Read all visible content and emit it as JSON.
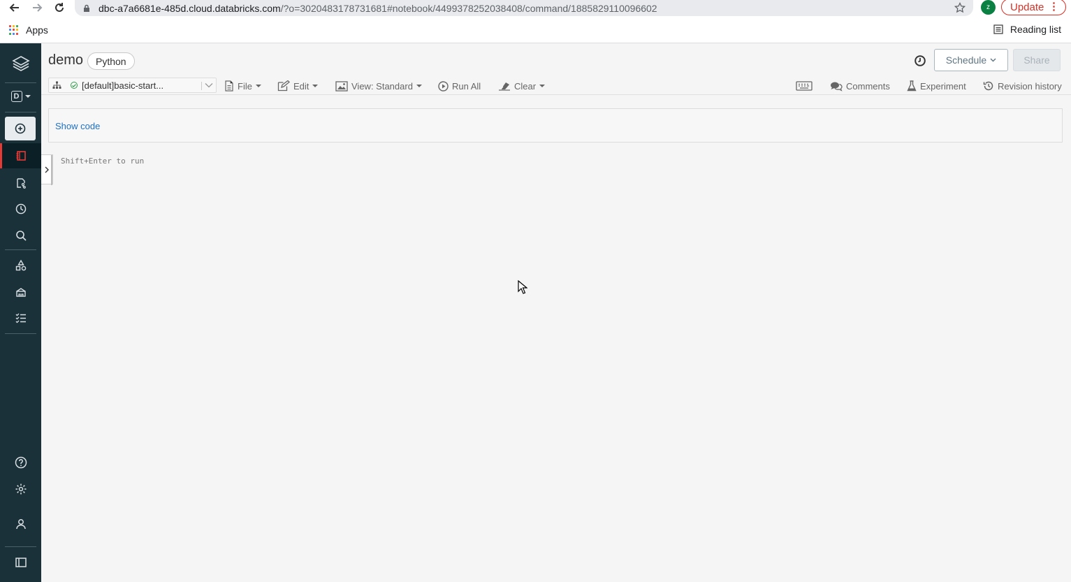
{
  "browser": {
    "url_host": "dbc-a7a6681e-485d.cloud.databricks.com",
    "url_path": "/?o=3020483178731681#notebook/4499378252038408/command/1885829110096602",
    "profile_initial": "z",
    "update_label": "Update",
    "bookmarks": {
      "apps_label": "Apps",
      "reading_list_label": "Reading list"
    }
  },
  "sidebar": {
    "workspace_letter": "D",
    "accent_color": "#e53935",
    "background_color": "#1b3139"
  },
  "notebook": {
    "title": "demo",
    "language": "Python",
    "schedule_label": "Schedule",
    "share_label": "Share"
  },
  "toolbar": {
    "cluster_name": "[default]basic-start...",
    "file_label": "File",
    "edit_label": "Edit",
    "view_label": "View: Standard",
    "run_all_label": "Run All",
    "clear_label": "Clear",
    "comments_label": "Comments",
    "experiment_label": "Experiment",
    "revision_history_label": "Revision history"
  },
  "content": {
    "show_code_label": "Show code",
    "cell_placeholder": "Shift+Enter to run"
  }
}
